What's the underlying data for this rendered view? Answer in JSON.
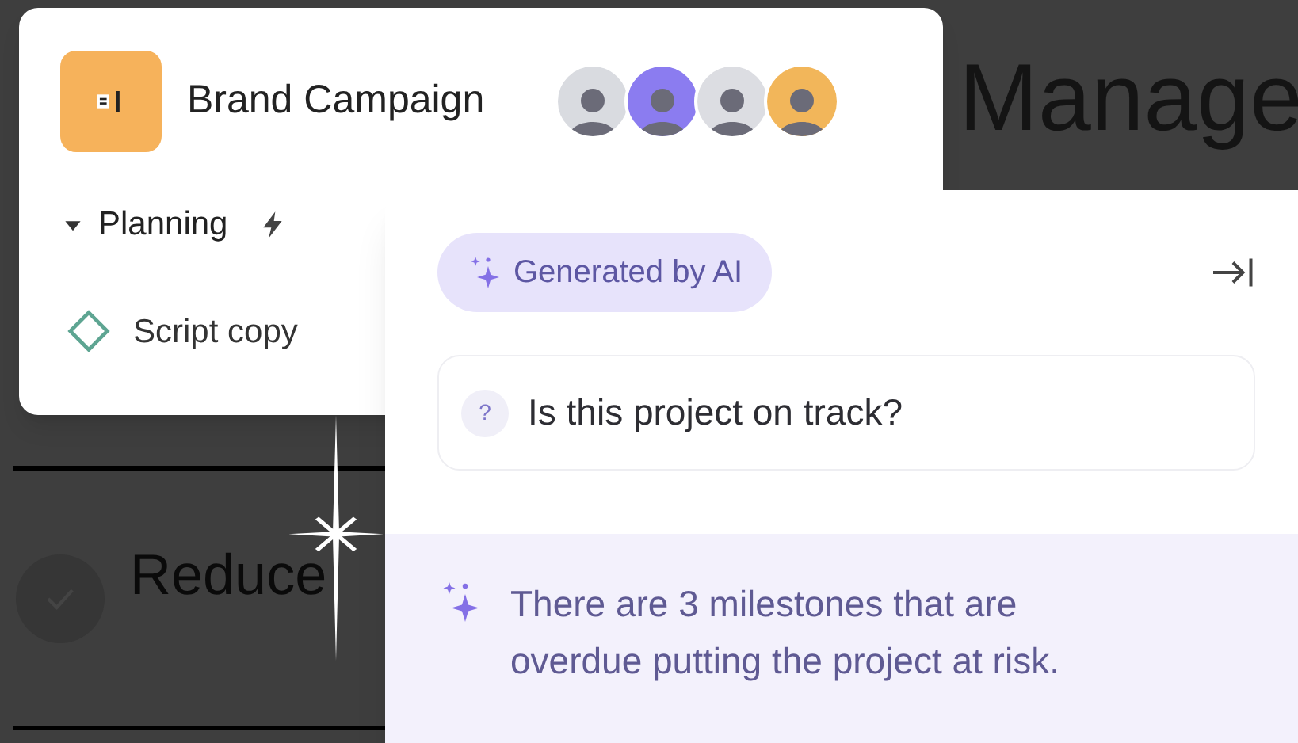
{
  "background": {
    "heading": "Manage",
    "task": {
      "label": "Reduce",
      "checked": false
    }
  },
  "project_card": {
    "title": "Brand Campaign",
    "avatars": [
      {
        "color": "#d9dbe0"
      },
      {
        "color": "#8b7cf0"
      },
      {
        "color": "#dcdde2"
      },
      {
        "color": "#f2b65a"
      }
    ],
    "section": {
      "label": "Planning",
      "expanded": true
    },
    "tasks": [
      {
        "label": "Script copy",
        "checked": false
      }
    ]
  },
  "ai_panel": {
    "badge": "Generated by AI",
    "question_mark": "?",
    "question": "Is this project on track?",
    "answer": "There are 3 milestones that are overdue putting the project at risk."
  }
}
